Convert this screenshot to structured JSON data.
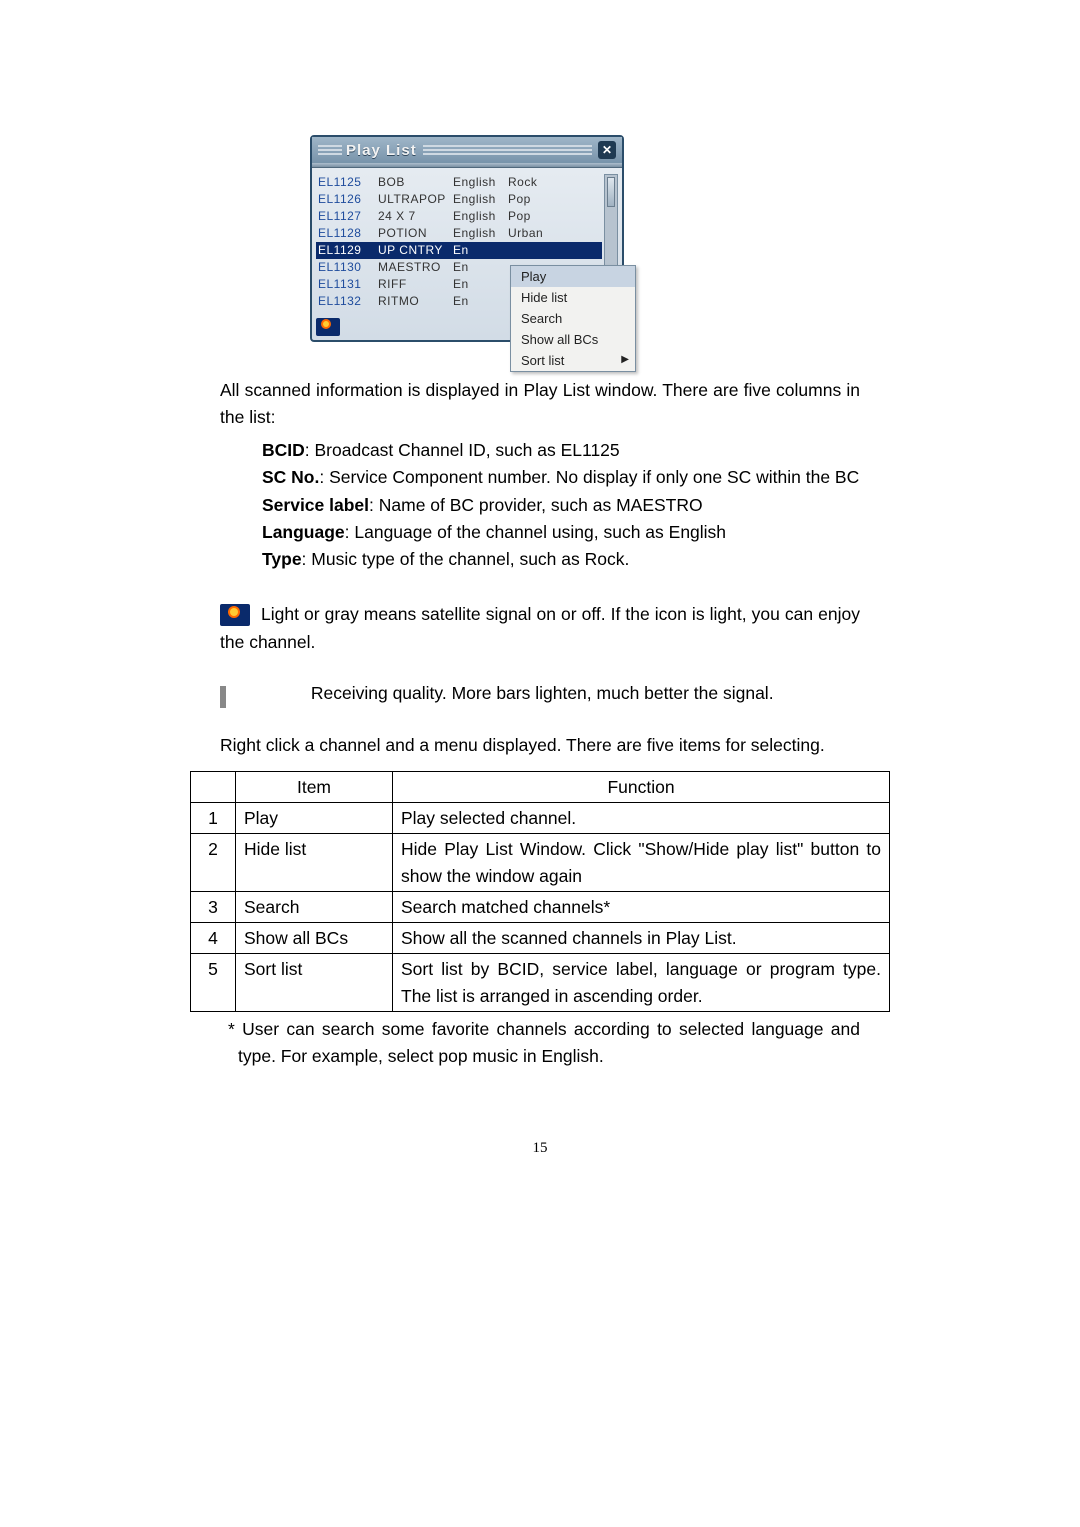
{
  "playlist_window": {
    "title": "Play List",
    "close_glyph": "✕",
    "rows": [
      {
        "bcid": "EL1125",
        "label": "BOB",
        "lang": "English",
        "type": "Rock",
        "selected": false
      },
      {
        "bcid": "EL1126",
        "label": "ULTRAPOP",
        "lang": "English",
        "type": "Pop",
        "selected": false
      },
      {
        "bcid": "EL1127",
        "label": "24 X 7",
        "lang": "English",
        "type": "Pop",
        "selected": false
      },
      {
        "bcid": "EL1128",
        "label": "POTION",
        "lang": "English",
        "type": "Urban",
        "selected": false
      },
      {
        "bcid": "EL1129",
        "label": "UP CNTRY",
        "lang": "En",
        "type": "",
        "selected": true
      },
      {
        "bcid": "EL1130",
        "label": "MAESTRO",
        "lang": "En",
        "type": "",
        "selected": false
      },
      {
        "bcid": "EL1131",
        "label": "RIFF",
        "lang": "En",
        "type": "",
        "selected": false
      },
      {
        "bcid": "EL1132",
        "label": "RITMO",
        "lang": "En",
        "type": "",
        "selected": false
      }
    ],
    "context_menu": {
      "items": [
        "Play",
        "Hide list",
        "Search",
        "Show all BCs",
        "Sort list"
      ],
      "highlighted_index": 0,
      "submenu_index": 4
    }
  },
  "body": {
    "intro1": "All scanned information is displayed in Play List window. There are five columns in the list:",
    "defs": {
      "bcid": {
        "label": "BCID",
        "text": ": Broadcast Channel ID, such as EL1125"
      },
      "scno": {
        "label": "SC No.",
        "text": ": Service Component number. No display if only one SC within the BC"
      },
      "service": {
        "label": "Service label",
        "text": ": Name of BC provider, such as MAESTRO"
      },
      "language": {
        "label": "Language",
        "text": ": Language of the channel using, such as English"
      },
      "type": {
        "label": "Type",
        "text": ": Music type of the channel, such as Rock."
      }
    },
    "icon_sat": " Light or gray means satellite signal on or off. If the icon is light, you can enjoy the channel.",
    "icon_bars": " Receiving quality. More bars lighten, much better the signal.",
    "rightclick": "Right click a channel and a menu displayed. There are five items for selecting."
  },
  "funcs_table": {
    "headers": [
      "",
      "Item",
      "Function"
    ],
    "rows": [
      {
        "n": "1",
        "item": "Play",
        "fn": "Play selected channel."
      },
      {
        "n": "2",
        "item": "Hide list",
        "fn": "Hide Play List Window. Click \"Show/Hide play list\" button to show the window again"
      },
      {
        "n": "3",
        "item": "Search",
        "fn": "Search matched channels*"
      },
      {
        "n": "4",
        "item": "Show all BCs",
        "fn": "Show all the scanned channels in Play List."
      },
      {
        "n": "5",
        "item": "Sort list",
        "fn": "Sort list by BCID, service label, language or program type. The list is arranged in ascending order."
      }
    ]
  },
  "footnote": "* User can search some favorite channels according to selected language and type. For example, select pop music in English.",
  "page_number": "15"
}
